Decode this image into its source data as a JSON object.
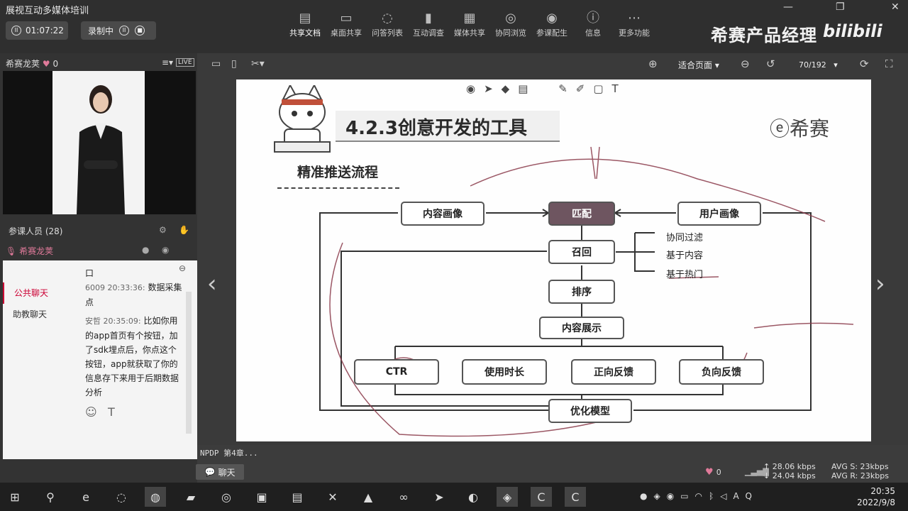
{
  "app": {
    "title": "展视互动多媒体培训",
    "timer": "01:07:22",
    "record_label": "录制中"
  },
  "toolbar": {
    "items": [
      {
        "label": "共享文档",
        "icon": "document-icon"
      },
      {
        "label": "桌面共享",
        "icon": "desktop-share-icon"
      },
      {
        "label": "问答列表",
        "icon": "qa-icon"
      },
      {
        "label": "互动调查",
        "icon": "survey-icon"
      },
      {
        "label": "媒体共享",
        "icon": "media-icon"
      },
      {
        "label": "协同浏览",
        "icon": "browse-icon"
      },
      {
        "label": "参课配生",
        "icon": "users-icon"
      },
      {
        "label": "信息",
        "icon": "info-icon"
      },
      {
        "label": "更多功能",
        "icon": "more-icon"
      }
    ]
  },
  "brand": {
    "name": "希赛产品经理",
    "bili": "bilibili"
  },
  "left": {
    "host": "希赛龙荚",
    "likes": "0",
    "live": "LIVE",
    "attendees": "参课人员 (28)",
    "speaker": "希赛龙荚",
    "tabs": [
      "公共聊天",
      "助教聊天"
    ],
    "messages": [
      {
        "meta": "6009 20:33:36:",
        "text": "数据采集点"
      },
      {
        "meta": "安哲 20:35:09:",
        "text": "比如你用的app首页有个按钮，加了sdk埋点后，你点这个按钮，app就获取了你的信息存下来用于后期数据分析"
      }
    ],
    "chat_button": "聊天"
  },
  "docbar": {
    "zoom": "适合页面",
    "page": "70/192"
  },
  "slide": {
    "heading": "4.2.3创意开发的工具",
    "subheading": "精准推送流程",
    "logo": "希赛",
    "boxes": {
      "content_profile": "内容画像",
      "match": "匹配",
      "user_profile": "用户画像",
      "recall": "召回",
      "rank": "排序",
      "display": "内容展示",
      "ctr": "CTR",
      "duration": "使用时长",
      "positive": "正向反馈",
      "negative": "负向反馈",
      "optimize": "优化模型"
    },
    "recall_methods": [
      "协同过滤",
      "基于内容",
      "基于热门"
    ]
  },
  "footer": {
    "note": "NPDP 第4章...",
    "likes": "0",
    "up": "28.06 kbps",
    "down": "24.04 kbps",
    "avg_s": "AVG S: 23kbps",
    "avg_r": "AVG R: 23kbps"
  },
  "taskbar": {
    "time": "20:35",
    "date": "2022/9/8"
  }
}
